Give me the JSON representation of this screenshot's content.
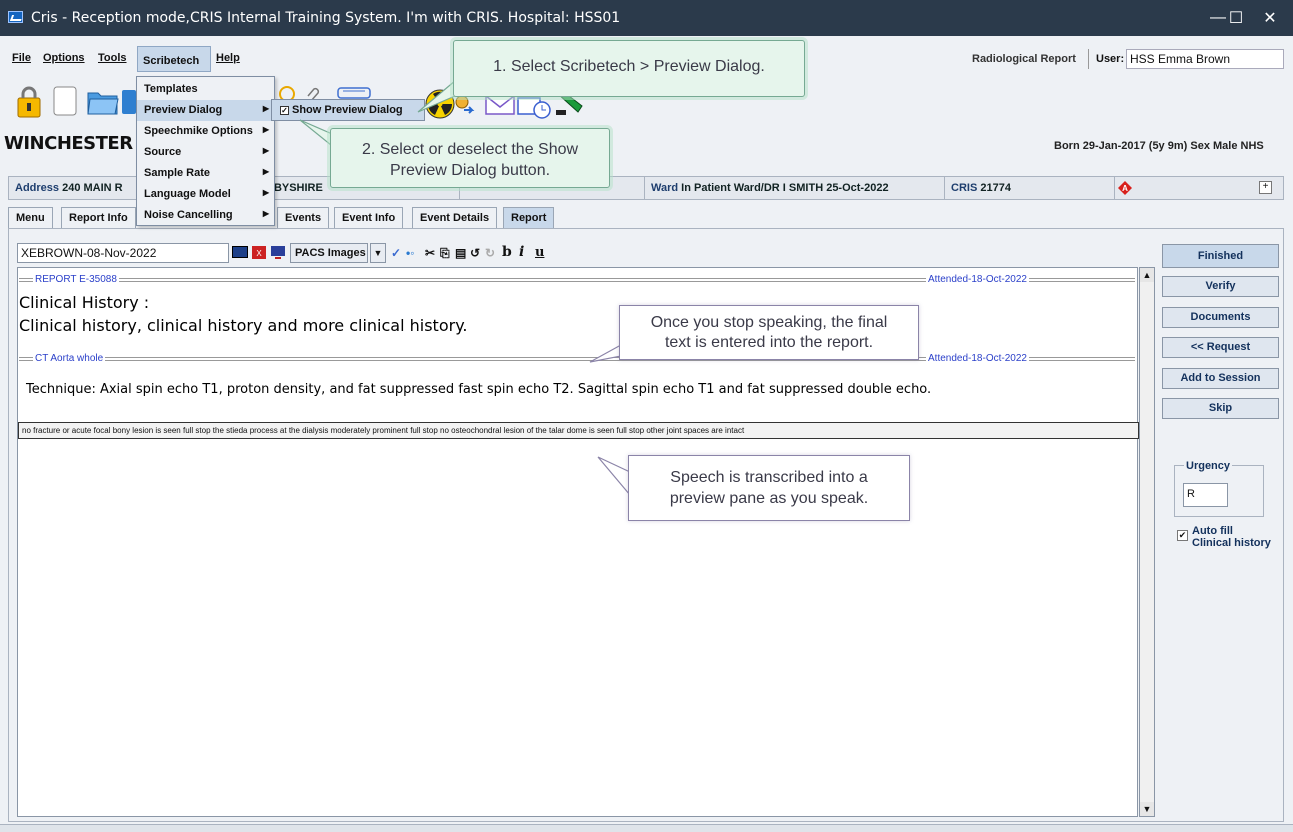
{
  "window": {
    "title": "Cris - Reception mode,CRIS Internal Training System. I'm with CRIS.   Hospital: HSS01",
    "minimize": "—",
    "maximize": "☐",
    "close": "✕"
  },
  "menubar": {
    "items": [
      "File",
      "Options",
      "Tools",
      "Scribetech",
      "Help"
    ],
    "report_label": "Radiological Report",
    "user_label": "User:",
    "user_value": "HSS Emma Brown"
  },
  "hospital": {
    "name": "WINCHESTER",
    "born_label": "Born",
    "born_value": "29-Jan-2017 (5y 9m)",
    "sex_label": "Sex",
    "sex_value": "Male",
    "nhs_label": "NHS"
  },
  "infobar": {
    "address_label": "Address",
    "address_value": "240 MAIN R",
    "address_tail": "RBYSHIRE",
    "ward_label": "Ward",
    "ward_value": "In Patient Ward/DR I SMITH 25-Oct-2022",
    "cris_label": "CRIS",
    "cris_value": "21774"
  },
  "tabs": [
    "Menu",
    "Report Info",
    "Events",
    "Event Info",
    "Event Details",
    "Report"
  ],
  "editor": {
    "doc_id": "XEBROWN-08-Nov-2022",
    "pacs_label": "PACS Images",
    "section1_label": "REPORT E-35088",
    "section1_attended": "Attended-18-Oct-2022",
    "heading": "Clinical History :",
    "history": "Clinical history, clinical history and more clinical history.",
    "section2_label": "CT Aorta whole",
    "section2_attended": "Attended-18-Oct-2022",
    "technique": "Technique: Axial spin echo T1, proton density, and fat suppressed fast spin echo T2. Sagittal spin echo T1 and fat suppressed double echo.",
    "preview_text": "no fracture or acute focal bony lesion is seen full stop the stieda process at the dialysis moderately prominent full stop no osteochondral lesion of the talar dome is seen full stop other joint spaces are intact"
  },
  "side_buttons": [
    "Finished",
    "Verify",
    "Documents",
    "<< Request",
    "Add to Session",
    "Skip"
  ],
  "urgency": {
    "title": "Urgency",
    "value": "R",
    "autofill_line1": "Auto fill",
    "autofill_line2": "Clinical history"
  },
  "scribetech_menu": {
    "items": [
      "Templates",
      "Preview Dialog",
      "Speechmike Options",
      "Source",
      "Sample Rate",
      "Language Model",
      "Noise Cancelling"
    ],
    "submenu_item": "Show Preview Dialog"
  },
  "callouts": {
    "step1": "1. Select Scribetech > Preview Dialog.",
    "step2_line1": "2. Select or deselect the Show",
    "step2_line2": "Preview Dialog button.",
    "final_line1": "Once you stop speaking, the final",
    "final_line2": "text is entered into the report.",
    "speech_line1": "Speech is transcribed into a",
    "speech_line2": "preview pane as you speak."
  },
  "colors": {
    "titlebar": "#2b3a4b",
    "accent_blue": "#2a3fc9",
    "selection": "#c8d8ea"
  }
}
